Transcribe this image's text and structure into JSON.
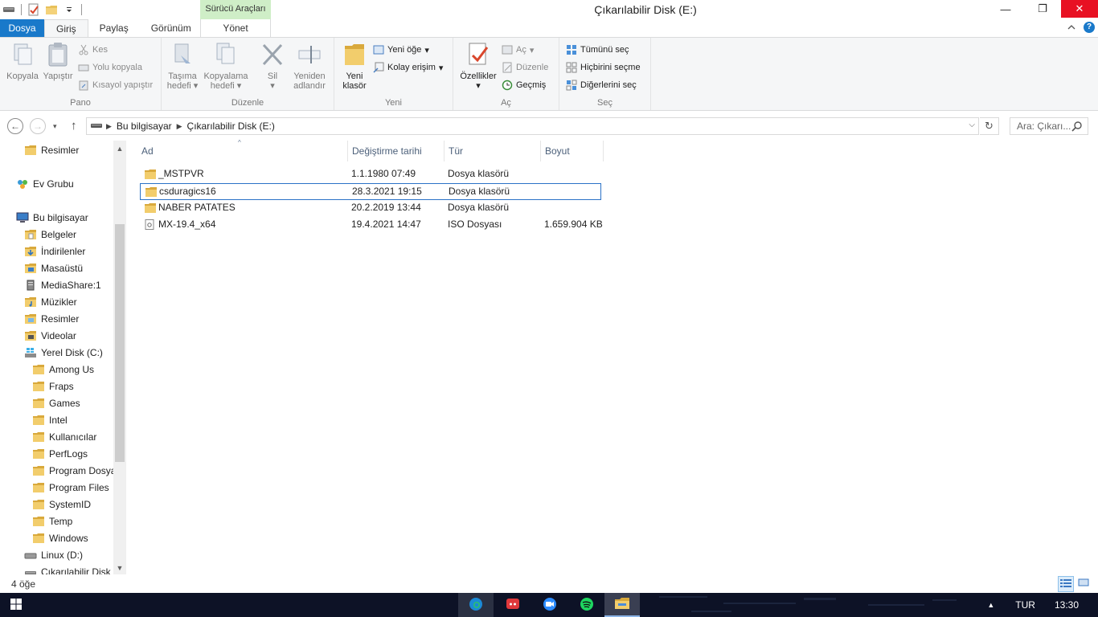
{
  "window": {
    "title": "Çıkarılabilir Disk (E:)",
    "context_group": "Sürücü Araçları",
    "controls": {
      "minimize": "—",
      "maximize": "❐",
      "close": "✕"
    }
  },
  "tabs": {
    "file": "Dosya",
    "home": "Giriş",
    "share": "Paylaş",
    "view": "Görünüm",
    "manage": "Yönet"
  },
  "ribbon": {
    "clipboard": {
      "label": "Pano",
      "copy": "Kopyala",
      "paste": "Yapıştır",
      "cut": "Kes",
      "copy_path": "Yolu kopyala",
      "paste_shortcut": "Kısayol yapıştır"
    },
    "organize": {
      "label": "Düzenle",
      "move_to": [
        "Taşıma",
        "hedefi"
      ],
      "copy_to": [
        "Kopyalama",
        "hedefi"
      ],
      "delete": "Sil",
      "rename": [
        "Yeniden",
        "adlandır"
      ]
    },
    "new": {
      "label": "Yeni",
      "new_folder": [
        "Yeni",
        "klasör"
      ],
      "new_item": "Yeni öğe",
      "easy_access": "Kolay erişim"
    },
    "open": {
      "label": "Aç",
      "properties": "Özellikler",
      "open": "Aç",
      "edit": "Düzenle",
      "history": "Geçmiş"
    },
    "select": {
      "label": "Seç",
      "select_all": "Tümünü seç",
      "select_none": "Hiçbirini seçme",
      "invert": "Diğerlerini seç"
    }
  },
  "address": {
    "crumbs": [
      "Bu bilgisayar",
      "Çıkarılabilir Disk (E:)"
    ],
    "search_placeholder": "Ara: Çıkarı..."
  },
  "nav_pane": [
    {
      "label": "Resimler",
      "icon": "folder-icon"
    },
    {
      "label": "Ev Grubu",
      "icon": "homegroup-icon"
    },
    {
      "label": "Bu bilgisayar",
      "icon": "computer-icon"
    },
    {
      "label": "Belgeler",
      "icon": "documents-icon"
    },
    {
      "label": "İndirilenler",
      "icon": "downloads-icon"
    },
    {
      "label": "Masaüstü",
      "icon": "desktop-icon"
    },
    {
      "label": "MediaShare:1",
      "icon": "media-server-icon"
    },
    {
      "label": "Müzikler",
      "icon": "music-icon"
    },
    {
      "label": "Resimler",
      "icon": "pictures-icon"
    },
    {
      "label": "Videolar",
      "icon": "videos-icon"
    },
    {
      "label": "Yerel Disk (C:)",
      "icon": "windows-drive-icon"
    },
    {
      "label": "Among Us",
      "icon": "folder-icon"
    },
    {
      "label": "Fraps",
      "icon": "folder-icon"
    },
    {
      "label": "Games",
      "icon": "folder-icon"
    },
    {
      "label": "Intel",
      "icon": "folder-icon"
    },
    {
      "label": "Kullanıcılar",
      "icon": "folder-icon"
    },
    {
      "label": "PerfLogs",
      "icon": "folder-icon"
    },
    {
      "label": "Program Dosya",
      "icon": "folder-icon"
    },
    {
      "label": "Program Files",
      "icon": "folder-icon"
    },
    {
      "label": "SystemID",
      "icon": "folder-icon"
    },
    {
      "label": "Temp",
      "icon": "folder-icon"
    },
    {
      "label": "Windows",
      "icon": "folder-icon"
    },
    {
      "label": "Linux (D:)",
      "icon": "drive-icon"
    },
    {
      "label": "Çıkarılabilir Disk (",
      "icon": "usb-drive-icon"
    }
  ],
  "columns": {
    "name": "Ad",
    "modified": "Değiştirme tarihi",
    "type": "Tür",
    "size": "Boyut"
  },
  "files": [
    {
      "name": "_MSTPVR",
      "modified": "1.1.1980 07:49",
      "type": "Dosya klasörü",
      "size": "",
      "icon": "folder-icon"
    },
    {
      "name": "csduragics16",
      "modified": "28.3.2021 19:15",
      "type": "Dosya klasörü",
      "size": "",
      "icon": "folder-icon",
      "selected": true
    },
    {
      "name": "NABER PATATES",
      "modified": "20.2.2019 13:44",
      "type": "Dosya klasörü",
      "size": "",
      "icon": "folder-icon"
    },
    {
      "name": "MX-19.4_x64",
      "modified": "19.4.2021 14:47",
      "type": "ISO Dosyası",
      "size": "1.659.904 KB",
      "icon": "iso-file-icon"
    }
  ],
  "status": {
    "count": "4 öğe"
  },
  "taskbar": {
    "apps": [
      "edge-icon",
      "discord-icon",
      "zoom-icon",
      "spotify-icon",
      "file-explorer-icon"
    ],
    "language": "TUR",
    "time": "13:30"
  },
  "colors": {
    "accent": "#1979ca",
    "context_tab": "#cfeec7",
    "folder": "#e8c15b",
    "taskbar": "#0d1226",
    "close": "#e81123"
  }
}
